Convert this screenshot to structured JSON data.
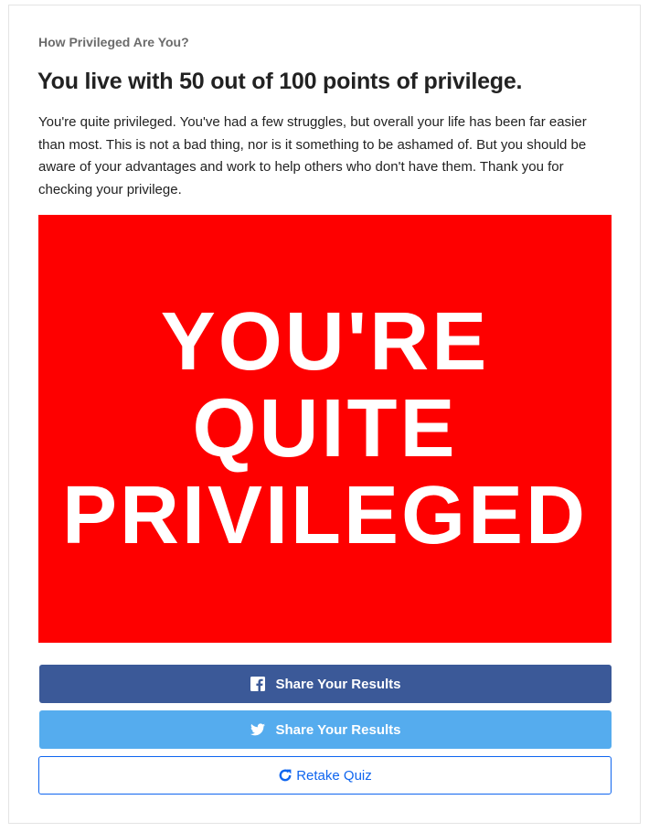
{
  "quiz": {
    "name": "How Privileged Are You?"
  },
  "result": {
    "title": "You live with 50 out of 100 points of privilege.",
    "description": "You're quite privileged. You've had a few struggles, but overall your life has been far easier than most. This is not a bad thing, nor is it something to be ashamed of. But you should be aware of your advantages and work to help others who don't have them. Thank you for checking your privilege.",
    "image": {
      "line1": "YOU'RE",
      "line2": "QUITE",
      "line3": "PRIVILEGED",
      "background_color": "#fe0000"
    }
  },
  "actions": {
    "facebook": {
      "label": "Share Your Results",
      "icon": "facebook-icon",
      "color": "#3b5998"
    },
    "twitter": {
      "label": "Share Your Results",
      "icon": "twitter-bird-icon",
      "color": "#55acee"
    },
    "retake": {
      "label": "Retake Quiz",
      "icon": "refresh-icon",
      "color": "#0f65ef"
    }
  }
}
